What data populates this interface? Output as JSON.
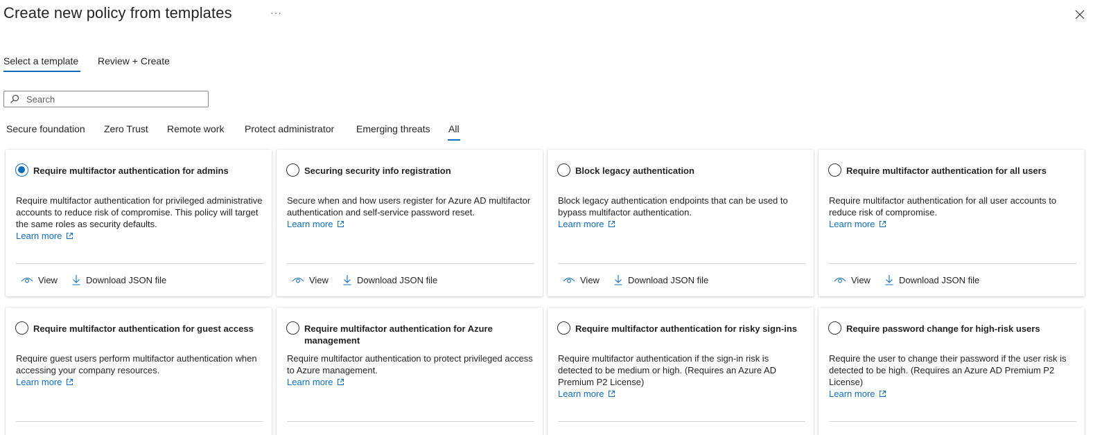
{
  "header": {
    "title": "Create new policy from templates",
    "more_label": "···",
    "close_icon": "close-icon"
  },
  "wizard_tabs": [
    {
      "label": "Select a template",
      "active": true
    },
    {
      "label": "Review + Create",
      "active": false
    }
  ],
  "search": {
    "placeholder": "Search",
    "value": ""
  },
  "filter_tabs": [
    {
      "label": "Secure foundation",
      "active": false
    },
    {
      "label": "Zero Trust",
      "active": false
    },
    {
      "label": "Remote work",
      "active": false
    },
    {
      "label": "Protect administrator",
      "active": false
    },
    {
      "label": "Emerging threats",
      "active": false
    },
    {
      "label": "All",
      "active": true
    }
  ],
  "colors": {
    "accent": "#0f6cbd",
    "text": "#242424",
    "divider": "#d1d1d1"
  },
  "cards": [
    {
      "title": "Require multifactor authentication for admins",
      "selected": true,
      "description": "Require multifactor authentication for privileged administrative accounts to reduce risk of compromise. This policy will target the same roles as security defaults.",
      "learn_more": "Learn more",
      "view_label": "View",
      "download_label": "Download JSON file"
    },
    {
      "title": "Securing security info registration",
      "selected": false,
      "description": "Secure when and how users register for Azure AD multifactor authentication and self-service password reset.",
      "learn_more": "Learn more",
      "view_label": "View",
      "download_label": "Download JSON file"
    },
    {
      "title": "Block legacy authentication",
      "selected": false,
      "description": "Block legacy authentication endpoints that can be used to bypass multifactor authentication.",
      "learn_more": "Learn more",
      "view_label": "View",
      "download_label": "Download JSON file"
    },
    {
      "title": "Require multifactor authentication for all users",
      "selected": false,
      "description": "Require multifactor authentication for all user accounts to reduce risk of compromise.",
      "learn_more": "Learn more",
      "view_label": "View",
      "download_label": "Download JSON file"
    },
    {
      "title": "Require multifactor authentication for guest access",
      "selected": false,
      "description": "Require guest users perform multifactor authentication when accessing your company resources.",
      "learn_more": "Learn more"
    },
    {
      "title": "Require multifactor authentication for Azure management",
      "selected": false,
      "description": "Require multifactor authentication to protect privileged access to Azure management.",
      "learn_more": "Learn more"
    },
    {
      "title": "Require multifactor authentication for risky sign-ins",
      "selected": false,
      "description": "Require multifactor authentication if the sign-in risk is detected to be medium or high. (Requires an Azure AD Premium P2 License)",
      "learn_more": "Learn more"
    },
    {
      "title": "Require password change for high-risk users",
      "selected": false,
      "description": "Require the user to change their password if the user risk is detected to be high. (Requires an Azure AD Premium P2 License)",
      "learn_more": "Learn more"
    }
  ]
}
